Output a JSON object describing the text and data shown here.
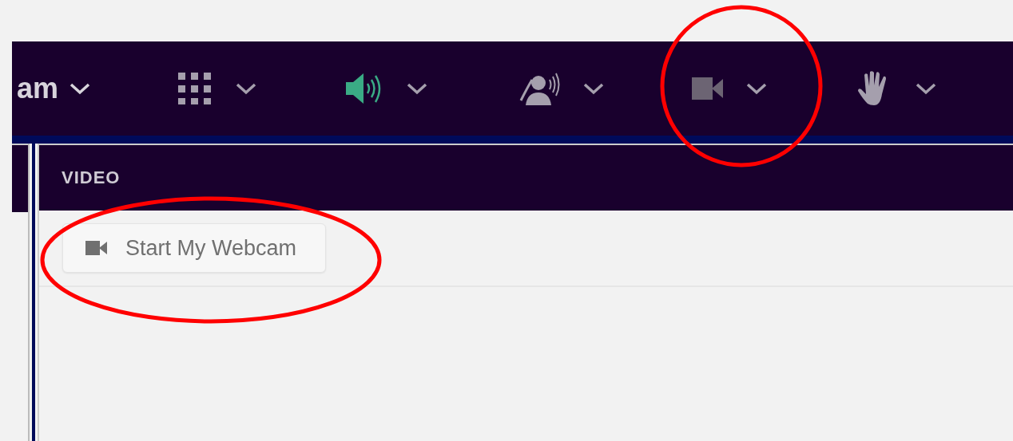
{
  "toolbar": {
    "title_fragment": "am",
    "items": [
      {
        "kind": "grid",
        "highlighted": false,
        "disabled": false
      },
      {
        "kind": "speaker",
        "highlighted": true,
        "disabled": false
      },
      {
        "kind": "speaking-person",
        "highlighted": false,
        "disabled": false
      },
      {
        "kind": "camera",
        "highlighted": false,
        "disabled": true
      },
      {
        "kind": "hand",
        "highlighted": false,
        "disabled": false
      }
    ]
  },
  "video_panel": {
    "title": "VIDEO",
    "start_button": "Start My Webcam"
  }
}
